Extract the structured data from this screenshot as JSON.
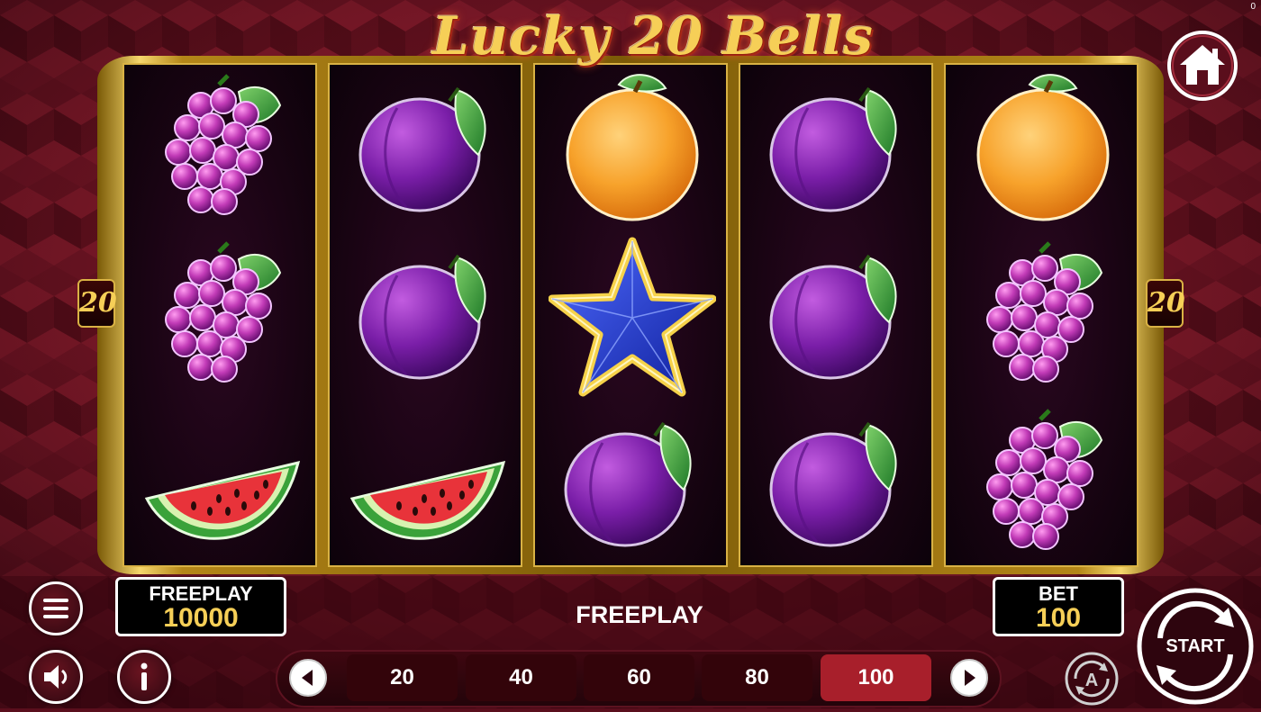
{
  "game": {
    "title": "Lucky 20 Bells",
    "corner_counter": "0"
  },
  "reels": [
    [
      "grapes",
      "grapes",
      "watermelon"
    ],
    [
      "plum",
      "plum",
      "watermelon"
    ],
    [
      "orange",
      "star",
      "plum"
    ],
    [
      "plum",
      "plum",
      "plum"
    ],
    [
      "orange",
      "grapes",
      "grapes"
    ]
  ],
  "line_badges": {
    "left": "20",
    "right": "20"
  },
  "balance": {
    "label": "FREEPLAY",
    "value": "10000"
  },
  "status": {
    "message": "FREEPLAY"
  },
  "bet": {
    "label": "BET",
    "value": "100",
    "options": [
      "20",
      "40",
      "60",
      "80",
      "100"
    ],
    "selected": "100"
  },
  "buttons": {
    "start_label": "START",
    "menu_icon": "hamburger-menu-icon",
    "sound_icon": "speaker-icon",
    "info_icon": "info-icon",
    "home_icon": "home-icon",
    "autoplay_icon": "autoplay-icon"
  },
  "colors": {
    "gold": "#f6cf57",
    "selected_bet": "#a81f2b",
    "background": "#5a0e1c"
  }
}
